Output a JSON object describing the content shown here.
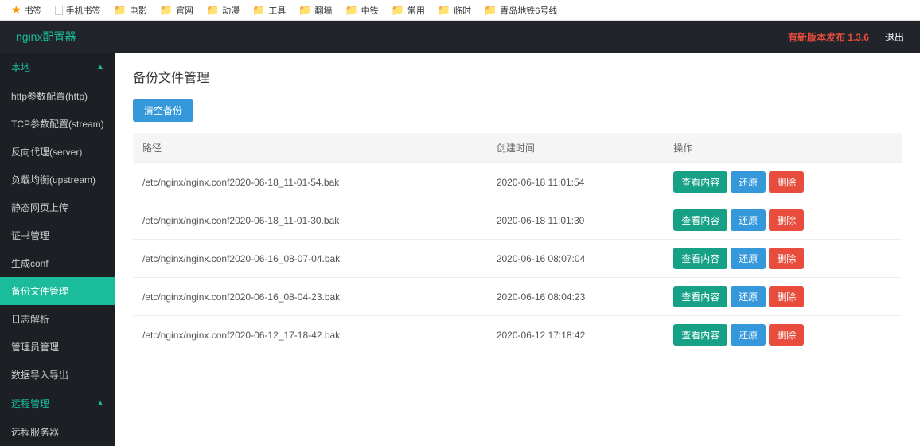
{
  "bookmarks": [
    {
      "icon": "star",
      "label": "书签"
    },
    {
      "icon": "page",
      "label": "手机书签"
    },
    {
      "icon": "folder",
      "label": "电影"
    },
    {
      "icon": "folder",
      "label": "官网"
    },
    {
      "icon": "folder",
      "label": "动漫"
    },
    {
      "icon": "folder",
      "label": "工具"
    },
    {
      "icon": "folder",
      "label": "翻墙"
    },
    {
      "icon": "folder",
      "label": "中铁"
    },
    {
      "icon": "folder",
      "label": "常用"
    },
    {
      "icon": "folder",
      "label": "临时"
    },
    {
      "icon": "folder",
      "label": "青岛地铁6号线"
    }
  ],
  "header": {
    "title": "nginx配置器",
    "version_notice": "有新版本发布 1.3.6",
    "logout": "退出"
  },
  "sidebar": {
    "sections": [
      {
        "title": "本地",
        "expanded": true,
        "items": [
          {
            "label": "http参数配置(http)",
            "active": false
          },
          {
            "label": "TCP参数配置(stream)",
            "active": false
          },
          {
            "label": "反向代理(server)",
            "active": false
          },
          {
            "label": "负载均衡(upstream)",
            "active": false
          },
          {
            "label": "静态网页上传",
            "active": false
          },
          {
            "label": "证书管理",
            "active": false
          },
          {
            "label": "生成conf",
            "active": false
          },
          {
            "label": "备份文件管理",
            "active": true
          },
          {
            "label": "日志解析",
            "active": false
          },
          {
            "label": "管理员管理",
            "active": false
          },
          {
            "label": "数据导入导出",
            "active": false
          }
        ]
      },
      {
        "title": "远程管理",
        "expanded": true,
        "items": [
          {
            "label": "远程服务器",
            "active": false
          }
        ]
      }
    ]
  },
  "main": {
    "page_title": "备份文件管理",
    "clear_button": "清空备份",
    "table": {
      "headers": {
        "path": "路径",
        "created": "创建时间",
        "actions": "操作"
      },
      "action_labels": {
        "view": "查看内容",
        "restore": "还原",
        "delete": "删除"
      },
      "rows": [
        {
          "path": "/etc/nginx/nginx.conf2020-06-18_11-01-54.bak",
          "created": "2020-06-18 11:01:54"
        },
        {
          "path": "/etc/nginx/nginx.conf2020-06-18_11-01-30.bak",
          "created": "2020-06-18 11:01:30"
        },
        {
          "path": "/etc/nginx/nginx.conf2020-06-16_08-07-04.bak",
          "created": "2020-06-16 08:07:04"
        },
        {
          "path": "/etc/nginx/nginx.conf2020-06-16_08-04-23.bak",
          "created": "2020-06-16 08:04:23"
        },
        {
          "path": "/etc/nginx/nginx.conf2020-06-12_17-18-42.bak",
          "created": "2020-06-12 17:18:42"
        }
      ]
    }
  }
}
